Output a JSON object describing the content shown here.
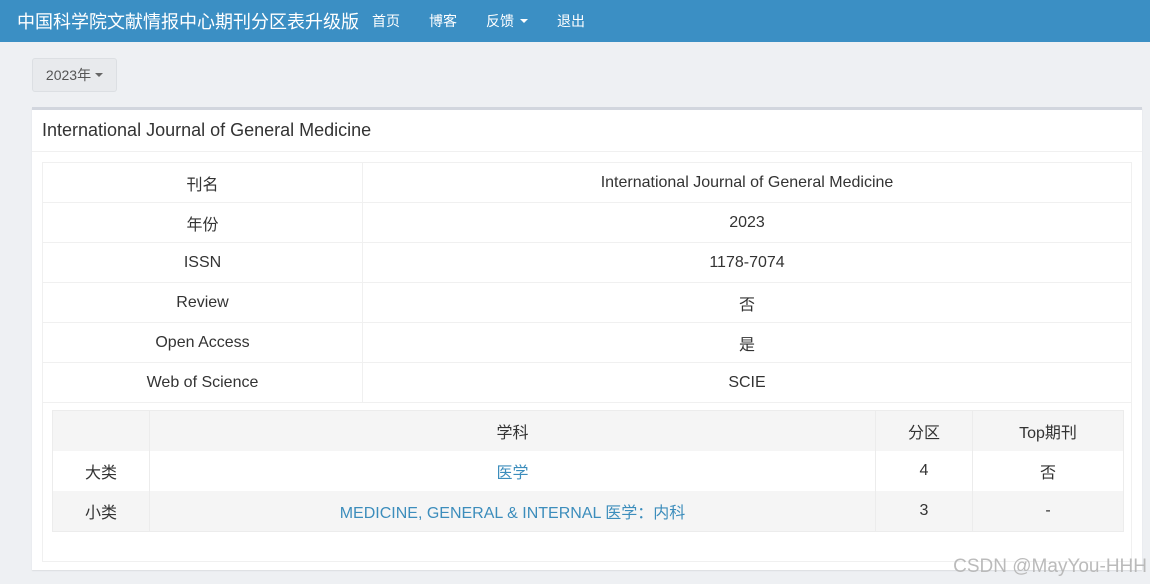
{
  "navbar": {
    "brand": "中国科学院文献情报中心期刊分区表升级版",
    "items": [
      {
        "label": "首页"
      },
      {
        "label": "博客"
      },
      {
        "label": "反馈"
      },
      {
        "label": "退出"
      }
    ]
  },
  "year_select": {
    "label": "2023年"
  },
  "journal": {
    "title": "International Journal of General Medicine",
    "info": [
      {
        "key": "刊名",
        "value": "International Journal of General Medicine"
      },
      {
        "key": "年份",
        "value": "2023"
      },
      {
        "key": "ISSN",
        "value": "1178-7074"
      },
      {
        "key": "Review",
        "value": "否"
      },
      {
        "key": "Open Access",
        "value": "是"
      },
      {
        "key": "Web of Science",
        "value": "SCIE"
      }
    ],
    "subject_table": {
      "headers": [
        "",
        "学科",
        "分区",
        "Top期刊"
      ],
      "rows": [
        {
          "category": "大类",
          "subject": "医学",
          "zone": "4",
          "top": "否"
        },
        {
          "category": "小类",
          "subject": "MEDICINE, GENERAL & INTERNAL 医学：内科",
          "zone": "3",
          "top": "-"
        }
      ]
    }
  },
  "watermark": "CSDN @MayYou-HHH"
}
